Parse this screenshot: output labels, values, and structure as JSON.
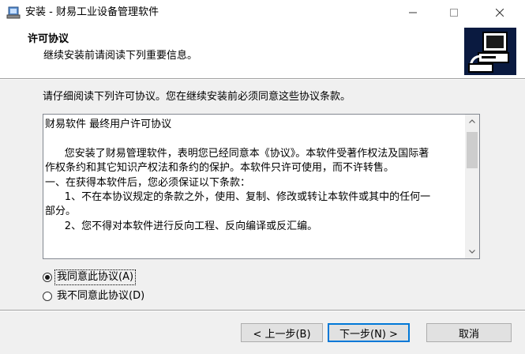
{
  "window": {
    "title": "安装 - 财易工业设备管理软件",
    "icons": {
      "app": "installer-icon",
      "minimize": "minimize-icon",
      "maximize": "maximize-icon",
      "close": "close-icon"
    }
  },
  "header": {
    "title": "许可协议",
    "subtitle": "继续安装前请阅读下列重要信息。",
    "image_icon": "computer-setup-icon"
  },
  "instruction": "请仔细阅读下列许可协议。您在继续安装前必须同意这些协议条款。",
  "license": {
    "text": "财易软件 最终用户许可协议\n\n      您安装了财易管理软件，表明您已经同意本《协议》。本软件受著作权法及国际著\n作权条约和其它知识产权法和条约的保护。本软件只许可使用，而不许转售。\n一、在获得本软件后，您必须保证以下条款：\n      1、不在本协议规定的条款之外，使用、复制、修改或转让本软件或其中的任何一\n部分。\n      2、您不得对本软件进行反向工程、反向编译或反汇编。",
    "scroll_icons": {
      "up": "scroll-up-arrow-icon",
      "down": "scroll-down-arrow-icon"
    }
  },
  "options": {
    "accept_label": "我同意此协议(A)",
    "decline_label": "我不同意此协议(D)",
    "selected": "accept"
  },
  "buttons": {
    "back": "< 上一步(B)",
    "next": "下一步(N) >",
    "cancel": "取消"
  }
}
